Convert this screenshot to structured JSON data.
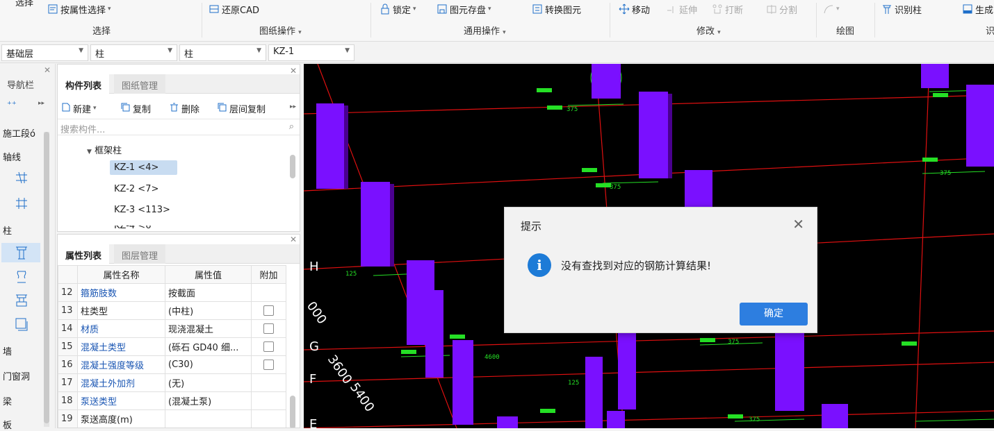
{
  "ribbon": {
    "cut_label": "选择",
    "items": [
      {
        "label": "按属性选择",
        "icon": "filter-icon",
        "caret": true
      },
      {
        "label": "还原CAD",
        "icon": "restore-cad-icon",
        "caret": false
      },
      {
        "label": "锁定",
        "icon": "lock-icon",
        "caret": true
      },
      {
        "label": "图元存盘",
        "icon": "save-element-icon",
        "caret": true
      },
      {
        "label": "转换图元",
        "icon": "convert-icon",
        "caret": false
      },
      {
        "label": "移动",
        "icon": "move-icon",
        "caret": false
      },
      {
        "label": "延伸",
        "icon": "extend-icon",
        "caret": false,
        "disabled": true
      },
      {
        "label": "打断",
        "icon": "break-icon",
        "caret": false,
        "disabled": true
      },
      {
        "label": "分割",
        "icon": "split-icon",
        "caret": false,
        "disabled": true
      },
      {
        "label": "识别柱",
        "icon": "identify-column-icon",
        "caret": false
      },
      {
        "label": "生成",
        "icon": "generate-icon",
        "caret": false
      }
    ],
    "groups": [
      "选择",
      "图纸操作",
      "通用操作",
      "修改",
      "绘图"
    ],
    "group_cut": "识"
  },
  "dropdowns": [
    {
      "value": "基础层"
    },
    {
      "value": "柱"
    },
    {
      "value": "柱"
    },
    {
      "value": "KZ-1"
    }
  ],
  "nav": {
    "title": "导航栏",
    "items": [
      {
        "label": "施工段ó"
      },
      {
        "label": "轴线"
      },
      {
        "label": "柱"
      },
      {
        "label": "墙"
      },
      {
        "label": "门窗洞"
      },
      {
        "label": "梁"
      },
      {
        "label": "板"
      }
    ]
  },
  "component_panel": {
    "tabs": [
      "构件列表",
      "图纸管理"
    ],
    "toolbar": {
      "new": "新建",
      "copy": "复制",
      "delete": "删除",
      "floor_copy": "层间复制"
    },
    "search_placeholder": "搜索构件...",
    "tree_group": "框架柱",
    "tree_items": [
      "KZ-1 <4>",
      "KZ-2 <7>",
      "KZ-3 <113>",
      "KZ-4 <6"
    ]
  },
  "property_panel": {
    "tabs": [
      "属性列表",
      "图层管理"
    ],
    "headers": [
      "属性名称",
      "属性值",
      "附加"
    ],
    "rows": [
      {
        "n": "12",
        "name": "箍筋肢数",
        "value": "按截面",
        "check": false,
        "blue": true
      },
      {
        "n": "13",
        "name": "柱类型",
        "value": "(中柱)",
        "check": true,
        "blue": false
      },
      {
        "n": "14",
        "name": "材质",
        "value": "现浇混凝土",
        "check": true,
        "blue": true
      },
      {
        "n": "15",
        "name": "混凝土类型",
        "value": "(砾石 GD40 细...",
        "check": true,
        "blue": true
      },
      {
        "n": "16",
        "name": "混凝土强度等级",
        "value": "(C30)",
        "check": true,
        "blue": true
      },
      {
        "n": "17",
        "name": "混凝土外加剂",
        "value": "(无)",
        "check": false,
        "blue": true
      },
      {
        "n": "18",
        "name": "泵送类型",
        "value": "(混凝土泵)",
        "check": false,
        "blue": true
      },
      {
        "n": "19",
        "name": "泵送高度(m)",
        "value": "",
        "check": false,
        "blue": false
      }
    ]
  },
  "viewport": {
    "axis_labels": [
      "H",
      "G",
      "F",
      "E"
    ],
    "dims": [
      "3600",
      "5400",
      "000",
      "375",
      "125",
      "4600"
    ]
  },
  "dialog": {
    "title": "提示",
    "message": "没有查找到对应的钢筋计算结果!",
    "ok": "确定"
  }
}
